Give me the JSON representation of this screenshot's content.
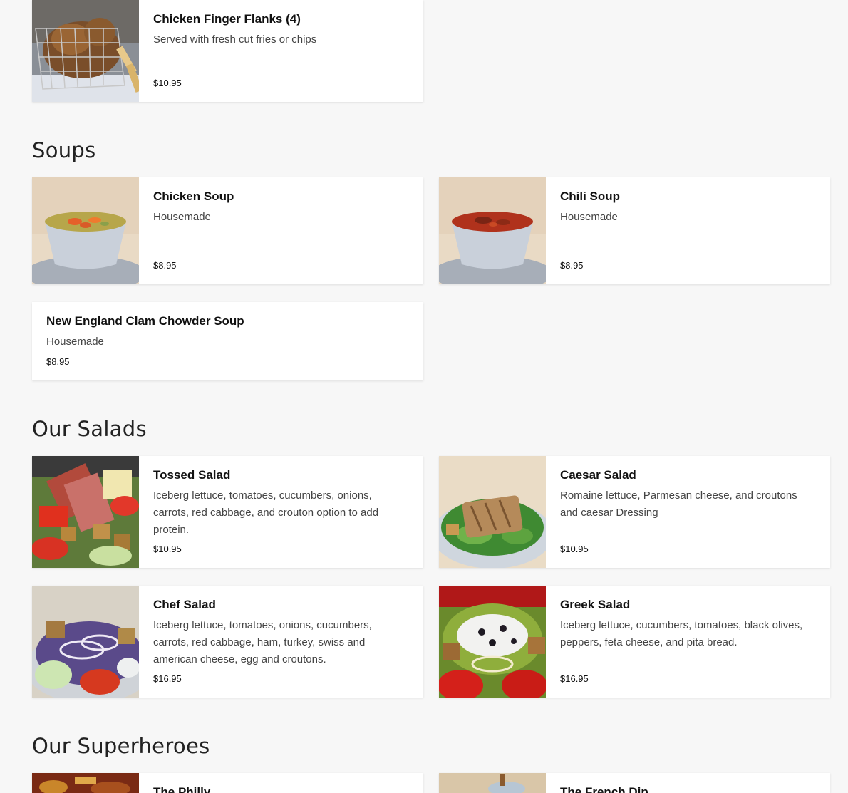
{
  "sections": [
    {
      "title": "",
      "items": [
        {
          "name": "Chicken Finger Flanks (4)",
          "description": "Served with fresh cut fries or chips",
          "price": "$10.95",
          "image": "chicken-fingers-basket"
        }
      ]
    },
    {
      "title": "Soups",
      "items": [
        {
          "name": "Chicken Soup",
          "description": "Housemade",
          "price": "$8.95",
          "image": "chicken-soup-bowl"
        },
        {
          "name": "Chili Soup",
          "description": "Housemade",
          "price": "$8.95",
          "image": "chili-soup-bowl"
        },
        {
          "name": "New England Clam Chowder Soup",
          "description": "Housemade",
          "price": "$8.95",
          "image": null
        }
      ]
    },
    {
      "title": "Our Salads",
      "items": [
        {
          "name": "Tossed Salad",
          "description": "Iceberg lettuce, tomatoes, cucumbers, onions, carrots, red cabbage, and crouton option to add protein.",
          "price": "$10.95",
          "image": "tossed-salad"
        },
        {
          "name": "Caesar Salad",
          "description": "Romaine lettuce, Parmesan cheese, and croutons and caesar Dressing",
          "price": "$10.95",
          "image": "caesar-salad"
        },
        {
          "name": "Chef Salad",
          "description": "Iceberg lettuce, tomatoes, onions, cucumbers, carrots, red cabbage, ham, turkey, swiss and american cheese, egg and croutons.",
          "price": "$16.95",
          "image": "chef-salad"
        },
        {
          "name": "Greek Salad",
          "description": "Iceberg lettuce, cucumbers, tomatoes, black olives, peppers, feta cheese, and pita bread.",
          "price": "$16.95",
          "image": "greek-salad"
        }
      ]
    },
    {
      "title": "Our Superheroes",
      "items": [
        {
          "name": "The Philly",
          "description": "",
          "price": "",
          "image": "philly-sandwich"
        },
        {
          "name": "The French Dip",
          "description": "",
          "price": "",
          "image": "french-dip-sandwich"
        }
      ]
    }
  ]
}
